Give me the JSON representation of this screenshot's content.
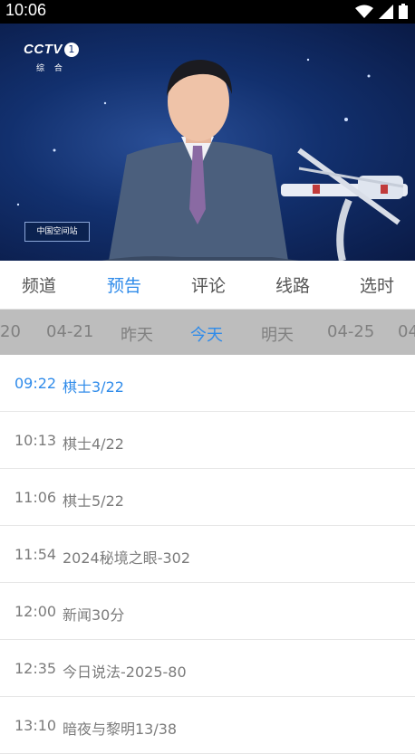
{
  "status_bar": {
    "time": "10:06"
  },
  "video": {
    "channel_logo": "CCTV",
    "channel_number": "1",
    "channel_sub": "综 合",
    "overlay_caption": "中国空间站"
  },
  "tabs": [
    {
      "label": "频道"
    },
    {
      "label": "预告"
    },
    {
      "label": "评论"
    },
    {
      "label": "线路"
    },
    {
      "label": "选时"
    }
  ],
  "active_tab": "预告",
  "dates": [
    {
      "label": "20"
    },
    {
      "label": "04-21"
    },
    {
      "label": "昨天"
    },
    {
      "label": "今天"
    },
    {
      "label": "明天"
    },
    {
      "label": "04-25"
    },
    {
      "label": "04"
    }
  ],
  "active_date": "今天",
  "schedule": [
    {
      "time": "09:22",
      "title": "棋士3/22"
    },
    {
      "time": "10:13",
      "title": "棋士4/22"
    },
    {
      "time": "11:06",
      "title": "棋士5/22"
    },
    {
      "time": "11:54",
      "title": "2024秘境之眼-302"
    },
    {
      "time": "12:00",
      "title": "新闻30分"
    },
    {
      "time": "12:35",
      "title": "今日说法-2025-80"
    },
    {
      "time": "13:10",
      "title": "暗夜与黎明13/38"
    }
  ],
  "active_program_index": 0,
  "colors": {
    "accent": "#2f8bea",
    "date_strip_bg": "#bdbdbd",
    "video_bg": "#12306e"
  }
}
